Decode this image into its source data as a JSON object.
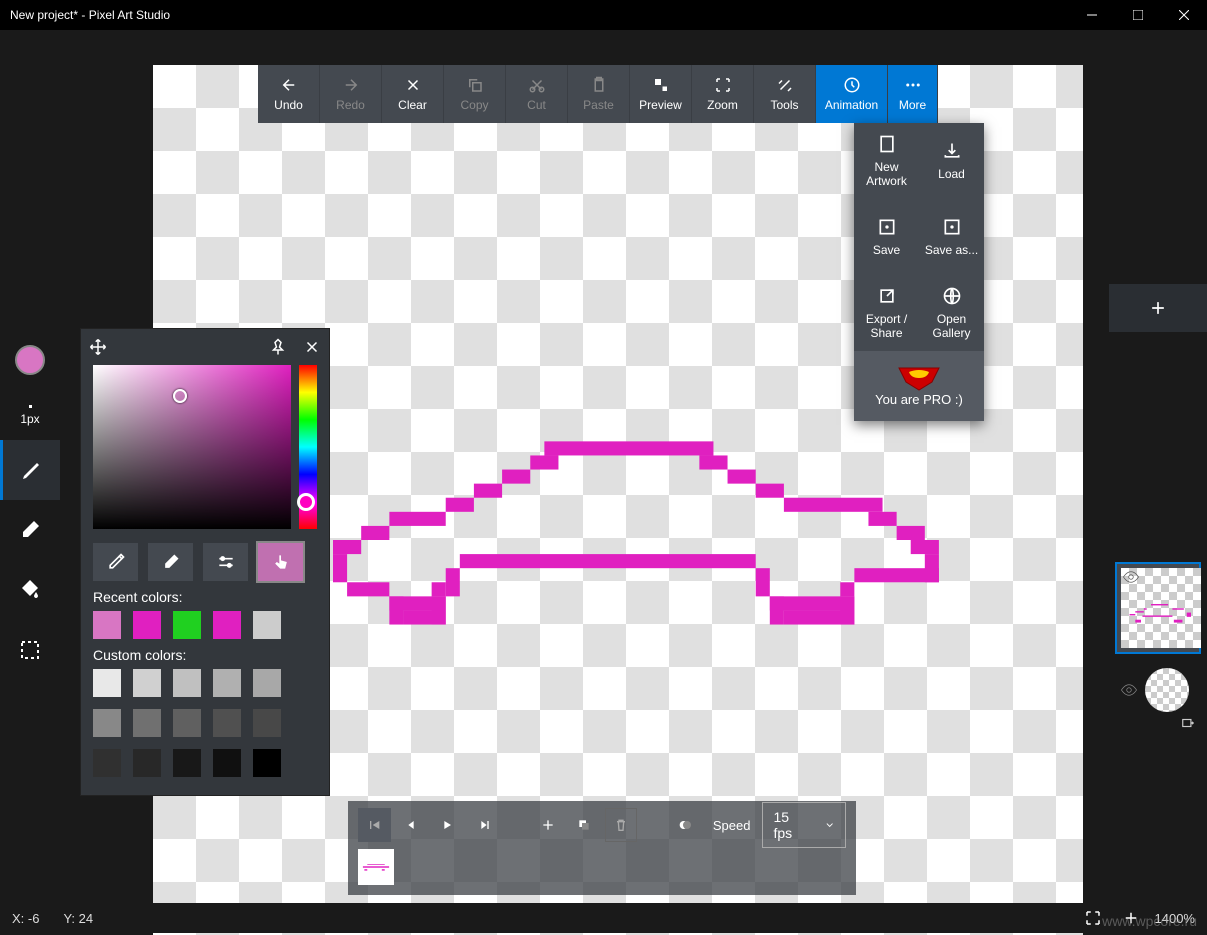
{
  "title": "New project* - Pixel Art Studio",
  "toolbar": {
    "undo": "Undo",
    "redo": "Redo",
    "clear": "Clear",
    "copy": "Copy",
    "cut": "Cut",
    "paste": "Paste",
    "preview": "Preview",
    "zoom": "Zoom",
    "tools": "Tools",
    "animation": "Animation",
    "more": "More"
  },
  "more_menu": {
    "new_artwork": "New Artwork",
    "load": "Load",
    "save": "Save",
    "save_as": "Save as...",
    "export_share": "Export / Share",
    "open_gallery": "Open Gallery",
    "pro": "You are PRO :)"
  },
  "brush_size": "1px",
  "color_panel": {
    "recent_label": "Recent colors:",
    "custom_label": "Custom colors:",
    "recent": [
      "#d876c3",
      "#e020c0",
      "#20d020",
      "#e020c0",
      "#cccccc"
    ],
    "custom": [
      "#e8e8e8",
      "#d0d0d0",
      "#c0c0c0",
      "#b0b0b0",
      "#a8a8a8",
      "#888888",
      "#707070",
      "#606060",
      "#505050",
      "#484848",
      "#303030",
      "#282828",
      "#181818",
      "#101010",
      "#000000"
    ]
  },
  "animation": {
    "speed_label": "Speed",
    "fps": "15 fps"
  },
  "status": {
    "x_label": "X: -6",
    "y_label": "Y: 24",
    "zoom": "1400%"
  },
  "watermark": "www.wpcore.ru",
  "pixel_color": "#e020c0"
}
